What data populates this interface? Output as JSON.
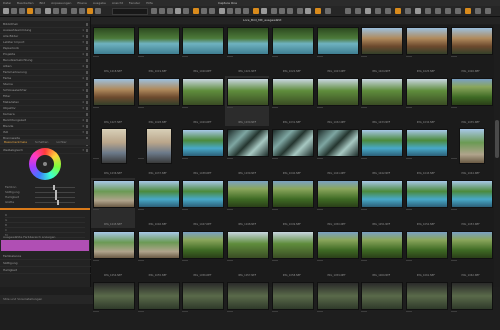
{
  "app": {
    "title": "Capture One"
  },
  "menubar": {
    "items": [
      "Datei",
      "Bearbeiten",
      "Bild",
      "Anpassungen",
      "Ebene",
      "Ausgabe",
      "Ansicht",
      "Fenster",
      "Hilfe"
    ]
  },
  "viewer": {
    "current_name": "Lore_Bild_Mit_ausgewählt"
  },
  "left_panel": {
    "library_rows": [
      {
        "label": "Bibliothek",
        "count": ""
      },
      {
        "label": "Auswahlsammlung",
        "count": "1"
      },
      {
        "label": "Alle Bilder",
        "count": "4"
      },
      {
        "label": "Letzter Import",
        "count": "3"
      },
      {
        "label": "Papierkorb",
        "count": ""
      },
      {
        "label": "Projekte",
        "count": "4"
      },
      {
        "label": "Benutzerbelichtung",
        "count": ""
      },
      {
        "label": "Alben",
        "count": "4"
      },
      {
        "label": "Farbmarkierung",
        "count": ""
      },
      {
        "label": "Farbe",
        "count": "4"
      },
      {
        "label": "Sterne",
        "count": ""
      },
      {
        "label": "Schlüsselwörter",
        "count": "1"
      },
      {
        "label": "Filter",
        "count": ""
      },
      {
        "label": "Metadaten",
        "count": "4"
      },
      {
        "label": "Objektiv",
        "count": "3"
      },
      {
        "label": "Kamera",
        "count": ""
      },
      {
        "label": "Belichtungszeit",
        "count": "4"
      },
      {
        "label": "Blende",
        "count": "4"
      },
      {
        "label": "ISO",
        "count": "3"
      },
      {
        "label": "Brennweite",
        "count": ""
      },
      {
        "label": "Farbbalance",
        "count": "4"
      },
      {
        "label": "Weißabgleich",
        "count": "3"
      }
    ],
    "tabs": [
      "Basismerkmale",
      "Schatten",
      "Lichter"
    ],
    "active_tab": 0,
    "sliders": [
      {
        "label": "Farbton",
        "value": 0.45
      },
      {
        "label": "Sättigung",
        "value": 0.5
      },
      {
        "label": "Helligkeit",
        "value": 0.5
      },
      {
        "label": "Glätte",
        "value": 0.55
      }
    ],
    "grid_rows": [
      "R",
      "G",
      "B",
      "C",
      "M"
    ],
    "swatch_label": "Ausgewählte Farbbereich anzeigen",
    "lower_rows": [
      "Farbbalance",
      "Sättigung",
      "Helligkeit"
    ],
    "bottom_label": "Stile und Voreinstellungen"
  },
  "thumbnails": {
    "rows": [
      [
        {
          "style": "p-pool",
          "caption": "IMG_1018.NEF"
        },
        {
          "style": "p-pool",
          "caption": "IMG_1019.NEF"
        },
        {
          "style": "p-pool",
          "caption": "IMG_1020.NEF"
        },
        {
          "style": "p-pool",
          "caption": "IMG_1021.NEF"
        },
        {
          "style": "p-pool",
          "caption": "IMG_1022.NEF"
        },
        {
          "style": "p-pool",
          "caption": "IMG_1023.NEF"
        },
        {
          "style": "p-hut",
          "caption": "IMG_1024.NEF"
        },
        {
          "style": "p-hut",
          "caption": "IMG_1025.NEF"
        },
        {
          "style": "p-hut",
          "caption": "IMG_1026.NEF"
        }
      ],
      [
        {
          "style": "p-hut",
          "caption": "IMG_1027.NEF"
        },
        {
          "style": "p-hut",
          "caption": "IMG_1028.NEF"
        },
        {
          "style": "p-tree",
          "caption": "IMG_1029.NEF"
        },
        {
          "style": "p-tree",
          "caption": "IMG_1030.NEF",
          "sel": true
        },
        {
          "style": "p-tree",
          "caption": "IMG_1031.NEF"
        },
        {
          "style": "p-tree",
          "caption": "IMG_1032.NEF"
        },
        {
          "style": "p-tree",
          "caption": "IMG_1033.NEF"
        },
        {
          "style": "p-tree",
          "caption": "IMG_1034.NEF"
        },
        {
          "style": "p-green",
          "caption": "IMG_1035.NEF"
        }
      ],
      [
        {
          "style": "p-people",
          "caption": "IMG_1036.NEF",
          "vertical": true
        },
        {
          "style": "p-people",
          "caption": "IMG_1037.NEF",
          "vertical": true
        },
        {
          "style": "p-blue",
          "caption": "IMG_1038.NEF"
        },
        {
          "style": "p-leaf",
          "caption": "IMG_1039.NEF"
        },
        {
          "style": "p-leaf",
          "caption": "IMG_1040.NEF"
        },
        {
          "style": "p-leaf",
          "caption": "IMG_1041.NEF"
        },
        {
          "style": "p-blue",
          "caption": "IMG_1042.NEF"
        },
        {
          "style": "p-blue",
          "caption": "IMG_1043.NEF"
        },
        {
          "style": "p-bridge",
          "caption": "IMG_1044.NEF",
          "vertical": true
        }
      ],
      [
        {
          "style": "p-bridge",
          "caption": "IMG_1045.NEF",
          "sel": true
        },
        {
          "style": "p-blue",
          "caption": "IMG_1046.NEF"
        },
        {
          "style": "p-blue",
          "caption": "IMG_1047.NEF"
        },
        {
          "style": "p-green",
          "caption": "IMG_1048.NEF"
        },
        {
          "style": "p-green",
          "caption": "IMG_1049.NEF"
        },
        {
          "style": "p-green",
          "caption": "IMG_1050.NEF"
        },
        {
          "style": "p-blue",
          "caption": "IMG_1051.NEF"
        },
        {
          "style": "p-blue",
          "caption": "IMG_1052.NEF"
        },
        {
          "style": "p-blue",
          "caption": "IMG_1053.NEF"
        }
      ],
      [
        {
          "style": "p-bridge",
          "caption": "IMG_1054.NEF"
        },
        {
          "style": "p-bridge",
          "caption": "IMG_1055.NEF"
        },
        {
          "style": "p-green",
          "caption": "IMG_1056.NEF"
        },
        {
          "style": "p-tree",
          "caption": "IMG_1057.NEF"
        },
        {
          "style": "p-tree",
          "caption": "IMG_1058.NEF"
        },
        {
          "style": "p-green",
          "caption": "IMG_1059.NEF"
        },
        {
          "style": "p-green",
          "caption": "IMG_1060.NEF"
        },
        {
          "style": "p-green",
          "caption": "IMG_1061.NEF"
        },
        {
          "style": "p-green",
          "caption": "IMG_1062.NEF"
        }
      ],
      [
        {
          "style": "p-dark",
          "caption": ""
        },
        {
          "style": "p-dark",
          "caption": ""
        },
        {
          "style": "p-dark",
          "caption": ""
        },
        {
          "style": "p-dark",
          "caption": ""
        },
        {
          "style": "p-dark",
          "caption": ""
        },
        {
          "style": "p-dark",
          "caption": ""
        },
        {
          "style": "p-dark",
          "caption": ""
        },
        {
          "style": "p-dark",
          "caption": ""
        },
        {
          "style": "p-dark",
          "caption": ""
        }
      ]
    ]
  },
  "colors": {
    "accent": "#d98b1c",
    "swatch": "#b04fb4",
    "panel": "#232323"
  }
}
